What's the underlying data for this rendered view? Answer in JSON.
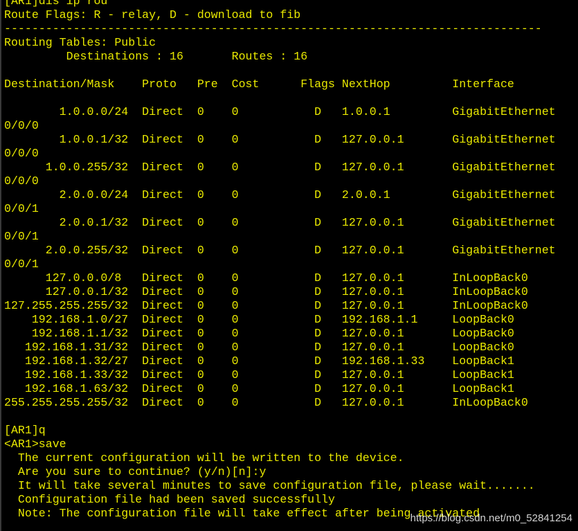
{
  "terminal": {
    "text_color": "#e8e800",
    "background": "#000000",
    "lines": [
      "[AR1]dis ip rou",
      "Route Flags: R - relay, D - download to fib",
      "------------------------------------------------------------------------------",
      "Routing Tables: Public",
      "         Destinations : 16       Routes : 16",
      "",
      "Destination/Mask    Proto   Pre  Cost      Flags NextHop         Interface",
      "",
      "        1.0.0.0/24  Direct  0    0           D   1.0.0.1         GigabitEthernet",
      "0/0/0",
      "        1.0.0.1/32  Direct  0    0           D   127.0.0.1       GigabitEthernet",
      "0/0/0",
      "      1.0.0.255/32  Direct  0    0           D   127.0.0.1       GigabitEthernet",
      "0/0/0",
      "        2.0.0.0/24  Direct  0    0           D   2.0.0.1         GigabitEthernet",
      "0/0/1",
      "        2.0.0.1/32  Direct  0    0           D   127.0.0.1       GigabitEthernet",
      "0/0/1",
      "      2.0.0.255/32  Direct  0    0           D   127.0.0.1       GigabitEthernet",
      "0/0/1",
      "      127.0.0.0/8   Direct  0    0           D   127.0.0.1       InLoopBack0",
      "      127.0.0.1/32  Direct  0    0           D   127.0.0.1       InLoopBack0",
      "127.255.255.255/32  Direct  0    0           D   127.0.0.1       InLoopBack0",
      "    192.168.1.0/27  Direct  0    0           D   192.168.1.1     LoopBack0",
      "    192.168.1.1/32  Direct  0    0           D   127.0.0.1       LoopBack0",
      "   192.168.1.31/32  Direct  0    0           D   127.0.0.1       LoopBack0",
      "   192.168.1.32/27  Direct  0    0           D   192.168.1.33    LoopBack1",
      "   192.168.1.33/32  Direct  0    0           D   127.0.0.1       LoopBack1",
      "   192.168.1.63/32  Direct  0    0           D   127.0.0.1       LoopBack1",
      "255.255.255.255/32  Direct  0    0           D   127.0.0.1       InLoopBack0",
      "",
      "[AR1]q",
      "<AR1>save",
      "  The current configuration will be written to the device.",
      "  Are you sure to continue? (y/n)[n]:y",
      "  It will take several minutes to save configuration file, please wait.......",
      "  Configuration file had been saved successfully",
      "  Note: The configuration file will take effect after being activated"
    ]
  },
  "watermark": {
    "text": "https://blog.csdn.net/m0_52841254"
  }
}
